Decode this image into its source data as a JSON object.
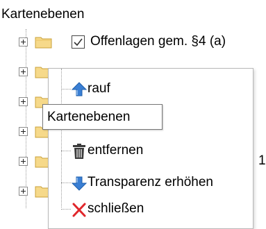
{
  "panel": {
    "title": "Kartenebenen"
  },
  "tree": {
    "rows": [
      {
        "label": "Offenlagen gem. §4 (a)",
        "checked": true
      },
      {
        "label": "",
        "checked": false
      },
      {
        "label": "",
        "checked": false
      },
      {
        "label": "",
        "checked": false
      },
      {
        "label": "",
        "checked": false
      },
      {
        "label": "",
        "checked": false
      }
    ],
    "row_partial_glyph": "1"
  },
  "context_menu": {
    "items": [
      {
        "label": "rauf",
        "icon": "arrow-up-icon"
      },
      {
        "label": "",
        "icon": ""
      },
      {
        "label": "entfernen",
        "icon": "trash-icon"
      },
      {
        "label": "Transparenz erhöhen",
        "icon": "arrow-down-icon"
      },
      {
        "label": "schließen",
        "icon": "close-x-icon"
      }
    ]
  },
  "tooltip": {
    "text": "Kartenebenen"
  },
  "colors": {
    "folder_fill": "#f6d98a",
    "folder_border": "#c9a13b",
    "arrow_up": "#3a7fd4",
    "arrow_down": "#3a7fd4",
    "trash": "#3b3b3b",
    "close_x": "#e0262b"
  }
}
